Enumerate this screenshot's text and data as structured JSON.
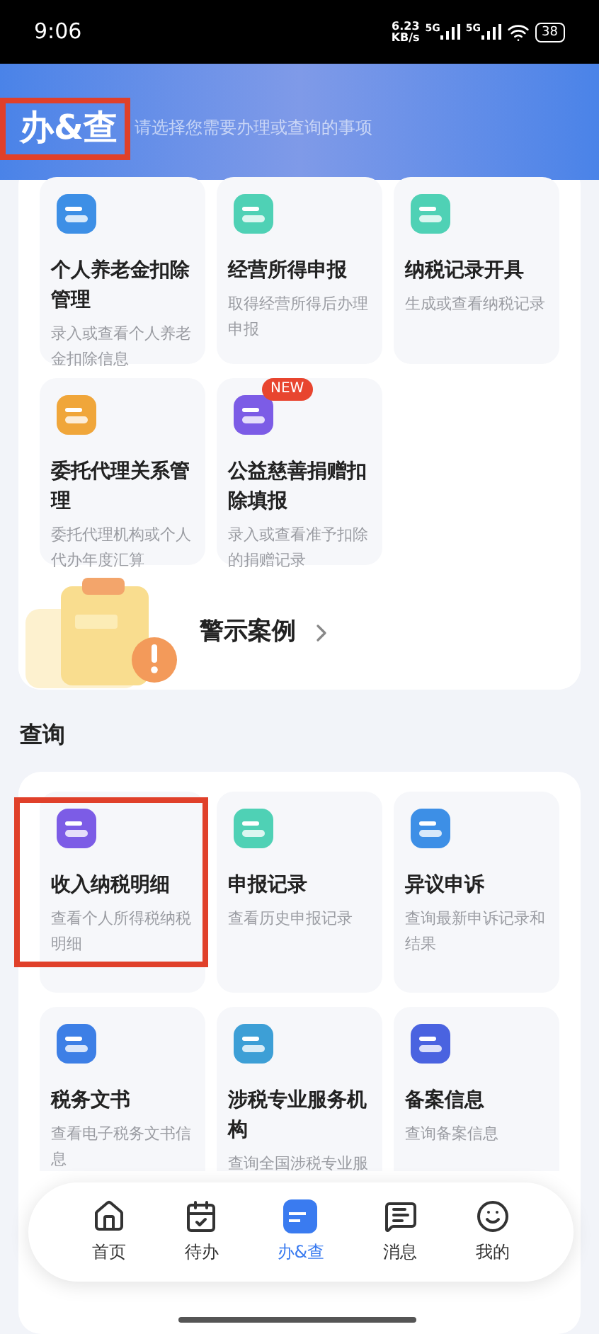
{
  "status_bar": {
    "time": "9:06",
    "net_speed": "6.23",
    "net_speed_unit": "KB/s",
    "signals": [
      "5G",
      "5G"
    ],
    "battery": "38"
  },
  "header": {
    "title": "办&查",
    "title_highlighted": true,
    "subtitle": "请选择您需要办理或查询的事项"
  },
  "handle_items": [
    {
      "title": "个人养老金扣除管理",
      "desc": "录入或查看个人养老金扣除信息",
      "color": "#3d8fe6"
    },
    {
      "title": "经营所得申报",
      "desc": "取得经营所得后办理申报",
      "color": "#4fd1b5"
    },
    {
      "title": "纳税记录开具",
      "desc": "生成或查看纳税记录",
      "color": "#4fd1b5"
    },
    {
      "title": "委托代理关系管理",
      "desc": "委托代理机构或个人代办年度汇算",
      "color": "#f0a63a"
    },
    {
      "title": "公益慈善捐赠扣除填报",
      "desc": "录入或查看准予扣除的捐赠记录",
      "color": "#7c5ce6",
      "badge": "NEW"
    }
  ],
  "warning_banner": {
    "label": "警示案例"
  },
  "query_section": {
    "title": "查询",
    "items": [
      {
        "title": "收入纳税明细",
        "desc": "查看个人所得税纳税明细",
        "color": "#7c5ce6",
        "highlighted": true
      },
      {
        "title": "申报记录",
        "desc": "查看历史申报记录",
        "color": "#4fd1b5",
        "highlighted": false
      },
      {
        "title": "异议申诉",
        "desc": "查询最新申诉记录和结果",
        "color": "#3d8fe6",
        "highlighted": false
      },
      {
        "title": "税务文书",
        "desc": "查看电子税务文书信息",
        "color": "#3d7fe6",
        "highlighted": false
      },
      {
        "title": "涉税专业服务机构",
        "desc": "查询全国涉税专业服",
        "color": "#3d9fd6",
        "highlighted": false
      },
      {
        "title": "备案信息",
        "desc": "查询备案信息",
        "color": "#4a63e0",
        "highlighted": false
      }
    ]
  },
  "bottom_nav": [
    {
      "label": "首页",
      "kind": "home",
      "selected": false
    },
    {
      "label": "待办",
      "kind": "todo",
      "selected": false
    },
    {
      "label": "办&查",
      "kind": "handle",
      "selected": true
    },
    {
      "label": "消息",
      "kind": "message",
      "selected": false
    },
    {
      "label": "我的",
      "kind": "profile",
      "selected": false
    }
  ]
}
